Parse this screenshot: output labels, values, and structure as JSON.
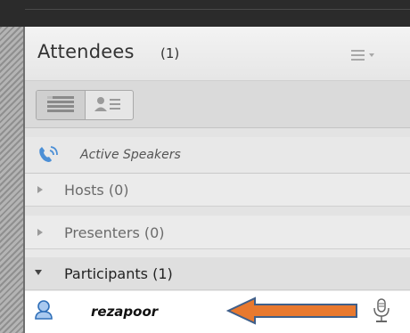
{
  "header": {
    "title": "Attendees",
    "count": "(1)",
    "menu_icon": "list-menu-icon"
  },
  "view_toggle": {
    "list_icon": "list-view-icon",
    "card_icon": "attendee-card-view-icon"
  },
  "sections": {
    "active_speakers": "Active Speakers",
    "hosts": "Hosts (0)",
    "presenters": "Presenters (0)",
    "participants": "Participants (1)"
  },
  "participants": [
    {
      "name": "rezapoor",
      "avatar_icon": "person-icon",
      "status_icon": "microphone-icon"
    }
  ],
  "annotation": {
    "icon": "orange-arrow-left",
    "color": "#e8792f"
  }
}
